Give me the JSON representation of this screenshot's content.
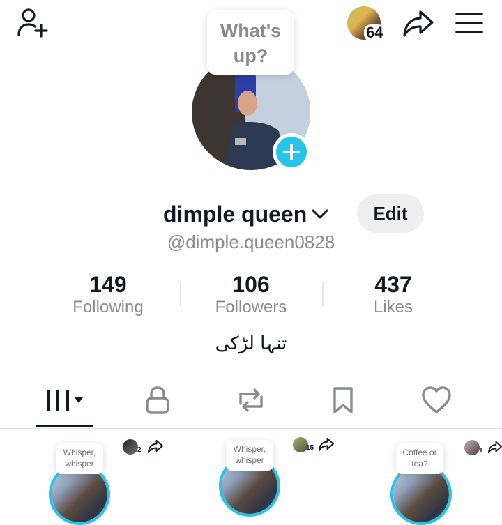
{
  "header": {
    "add_friend_icon": "person-plus-icon",
    "notif_avatar_count": "64",
    "share_icon": "share-arrow-icon",
    "menu_icon": "hamburger-icon"
  },
  "profile": {
    "bubble_text": "What's up?",
    "name": "dimple queen",
    "username": "@dimple.queen0828",
    "edit_label": "Edit",
    "bio": "تنہا لڑکی"
  },
  "stats": [
    {
      "value": "149",
      "label": "Following"
    },
    {
      "value": "106",
      "label": "Followers"
    },
    {
      "value": "437",
      "label": "Likes"
    }
  ],
  "tabs": [
    {
      "icon": "grid-icon",
      "active": true
    },
    {
      "icon": "lock-icon",
      "active": false
    },
    {
      "icon": "repost-icon",
      "active": false
    },
    {
      "icon": "bookmark-icon",
      "active": false
    },
    {
      "icon": "heart-icon",
      "active": false
    }
  ],
  "cards": [
    {
      "bubble": "Whisper, whisper",
      "count": "2"
    },
    {
      "bubble": "Whisper, whisper",
      "count": "15"
    },
    {
      "bubble": "Coffee or tea?",
      "count": "1"
    }
  ],
  "colors": {
    "accent": "#25c4ea",
    "text_primary": "#161823",
    "text_secondary": "#8a8b91",
    "edit_bg": "#efefef"
  }
}
